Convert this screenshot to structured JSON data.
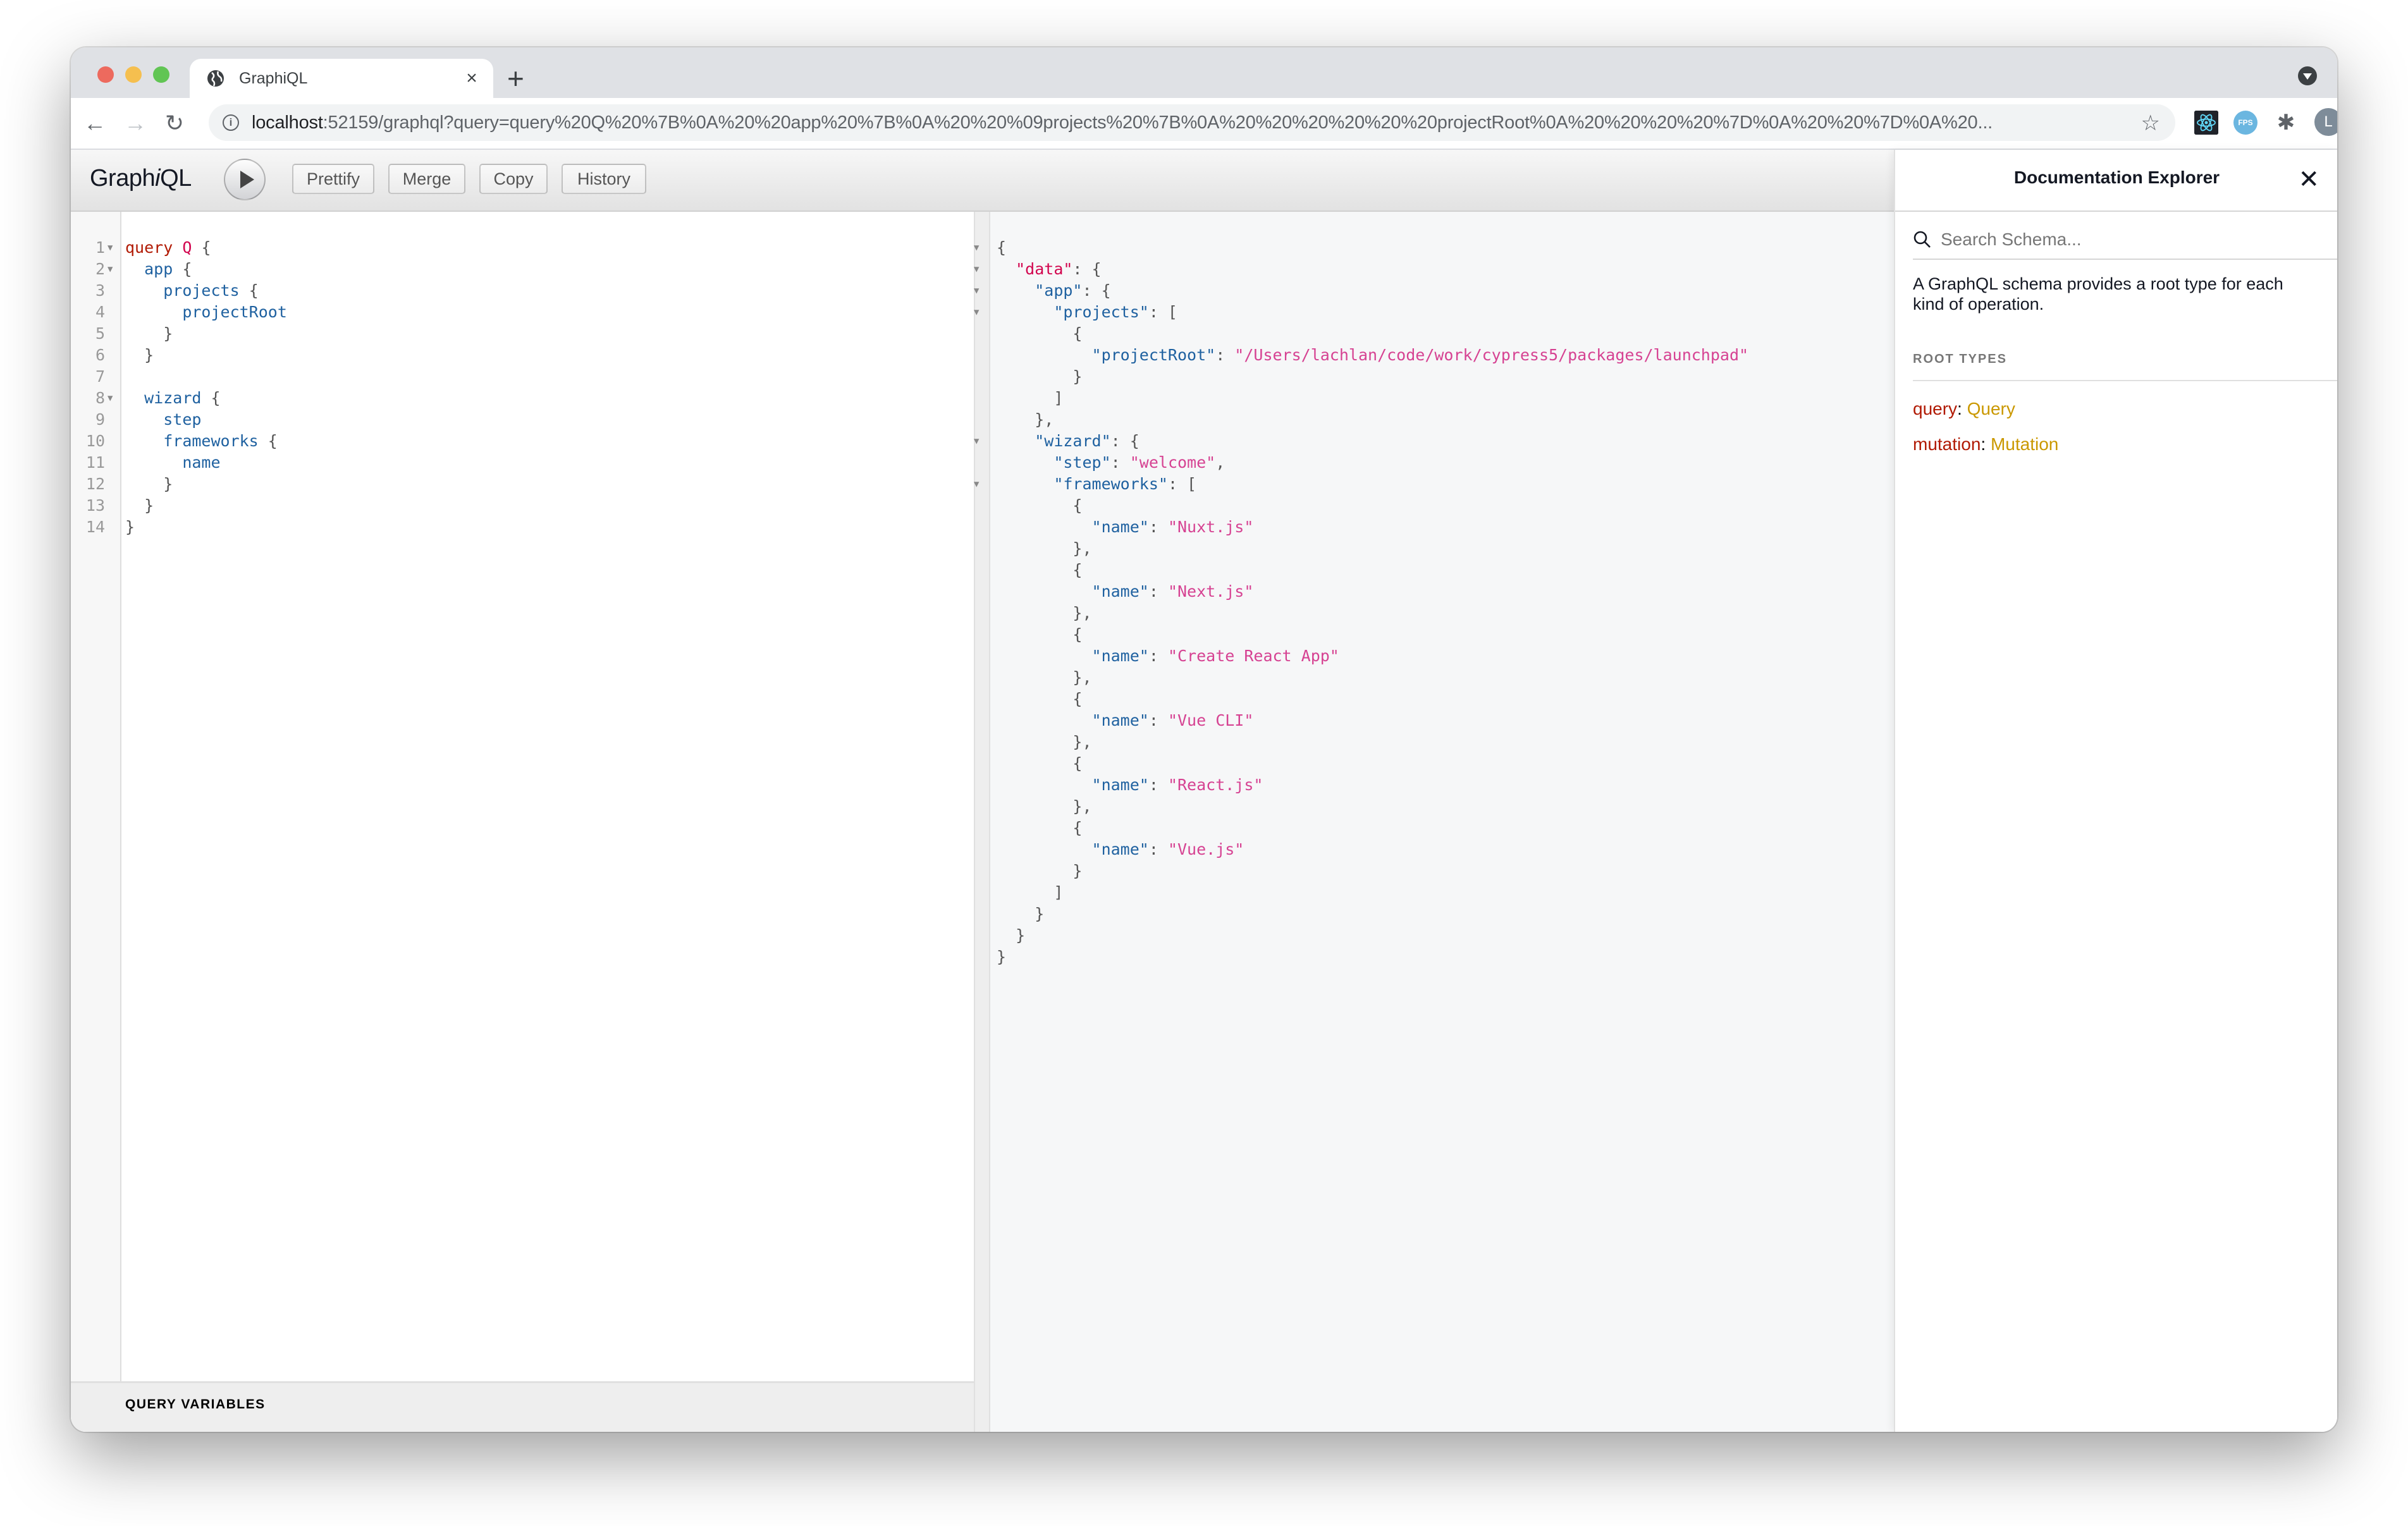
{
  "browser": {
    "tab_title": "GraphiQL",
    "tab_close": "×",
    "new_tab": "+",
    "url_host": "localhost",
    "url_rest": ":52159/graphql?query=query%20Q%20%7B%0A%20%20app%20%7B%0A%20%20%09projects%20%7B%0A%20%20%20%20%20%20projectRoot%0A%20%20%20%20%7D%0A%20%20%7D%0A%20...",
    "avatar_initial": "L",
    "ext_fps_label": "FPS"
  },
  "graphiql": {
    "title_pre": "Graph",
    "title_i": "i",
    "title_post": "QL",
    "buttons": {
      "prettify": "Prettify",
      "merge": "Merge",
      "copy": "Copy",
      "history": "History"
    },
    "query_variables_label": "QUERY VARIABLES"
  },
  "query_editor": {
    "lines": [
      {
        "n": "1",
        "fold": true
      },
      {
        "n": "2",
        "fold": true
      },
      {
        "n": "3",
        "fold": false
      },
      {
        "n": "4",
        "fold": false
      },
      {
        "n": "5",
        "fold": false
      },
      {
        "n": "6",
        "fold": false
      },
      {
        "n": "7",
        "fold": false
      },
      {
        "n": "8",
        "fold": true
      },
      {
        "n": "9",
        "fold": false
      },
      {
        "n": "10",
        "fold": false
      },
      {
        "n": "11",
        "fold": false
      },
      {
        "n": "12",
        "fold": false
      },
      {
        "n": "13",
        "fold": false
      },
      {
        "n": "14",
        "fold": false
      }
    ],
    "tokens": {
      "query_kw": "query",
      "op_name": "Q",
      "app": "app",
      "projects": "projects",
      "projectRoot": "projectRoot",
      "wizard": "wizard",
      "step": "step",
      "frameworks": "frameworks",
      "name": "name"
    }
  },
  "result": {
    "projectRoot": "\"/Users/lachlan/code/work/cypress5/packages/launchpad\"",
    "step": "\"welcome\"",
    "frameworks": [
      "\"Nuxt.js\"",
      "\"Next.js\"",
      "\"Create React App\"",
      "\"Vue CLI\"",
      "\"React.js\"",
      "\"Vue.js\""
    ]
  },
  "docs": {
    "title": "Documentation Explorer",
    "search_placeholder": "Search Schema...",
    "description": "A GraphQL schema provides a root type for each kind of operation.",
    "section_label": "ROOT TYPES",
    "root_types": [
      {
        "field": "query",
        "type": "Query"
      },
      {
        "field": "mutation",
        "type": "Mutation"
      }
    ]
  },
  "colors": {
    "keyword": "#b11a04",
    "def": "#d2054e",
    "property": "#1f61a0",
    "string": "#d64292",
    "type_name": "#ca9800"
  }
}
